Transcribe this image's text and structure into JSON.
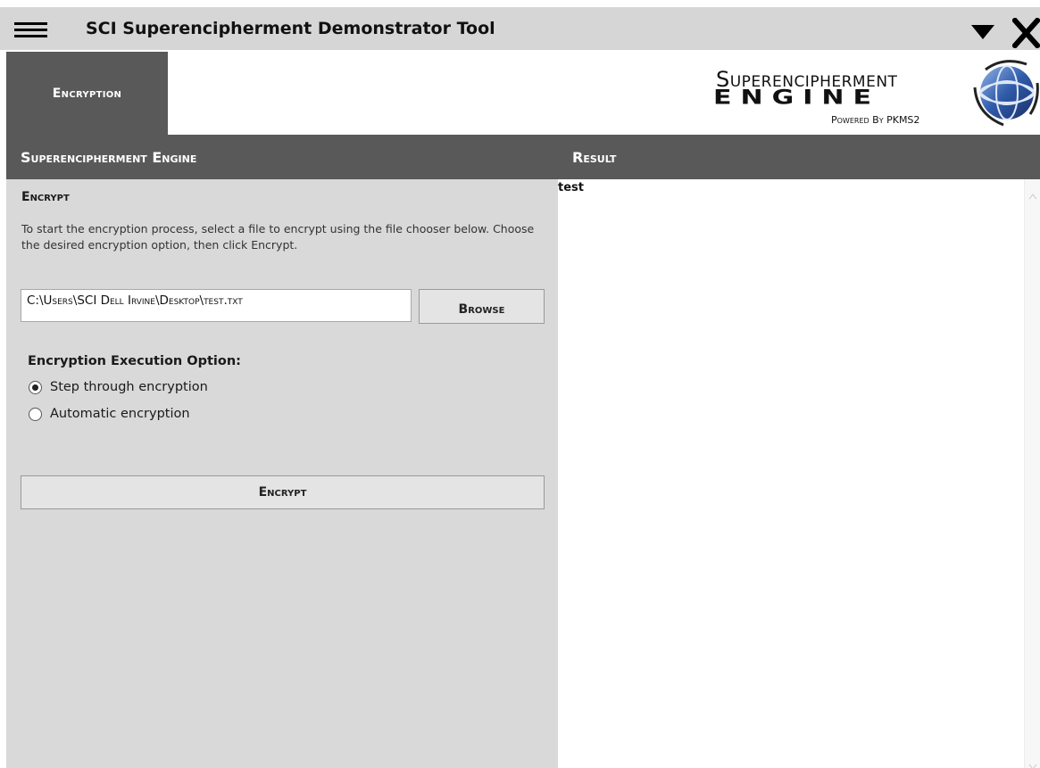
{
  "window": {
    "title": "SCI Superencipherment Demonstrator Tool",
    "menu_icon": "hamburger-menu-icon",
    "dropdown_icon": "triangle-down-icon",
    "close_icon": "close-x-icon"
  },
  "tabs": [
    {
      "label": "Encryption",
      "active": true
    }
  ],
  "logo": {
    "line1": "Superencipherment",
    "line2": "ENGINE",
    "line3": "Powered By PKMS2",
    "icon": "globe-logo-icon"
  },
  "left_panel": {
    "header": "Superencipherment Engine",
    "section_title": "Encrypt",
    "instructions": "To start the encryption process, select a file to encrypt using the file chooser below. Choose the desired encryption option, then click Encrypt.",
    "file_path": "C:\\Users\\SCI Dell Irvine\\Desktop\\test.txt",
    "browse_label": "Browse",
    "option_label": "Encryption Execution Option:",
    "options": [
      {
        "label": "Step through encryption",
        "selected": true
      },
      {
        "label": "Automatic encryption",
        "selected": false
      }
    ],
    "encrypt_label": "Encrypt"
  },
  "right_panel": {
    "header": "Result",
    "text": "test"
  },
  "colors": {
    "titlebar_bg": "#d6d6d6",
    "header_bg": "#595959",
    "panel_bg": "#d9d9d9",
    "button_bg": "#e4e4e4"
  }
}
